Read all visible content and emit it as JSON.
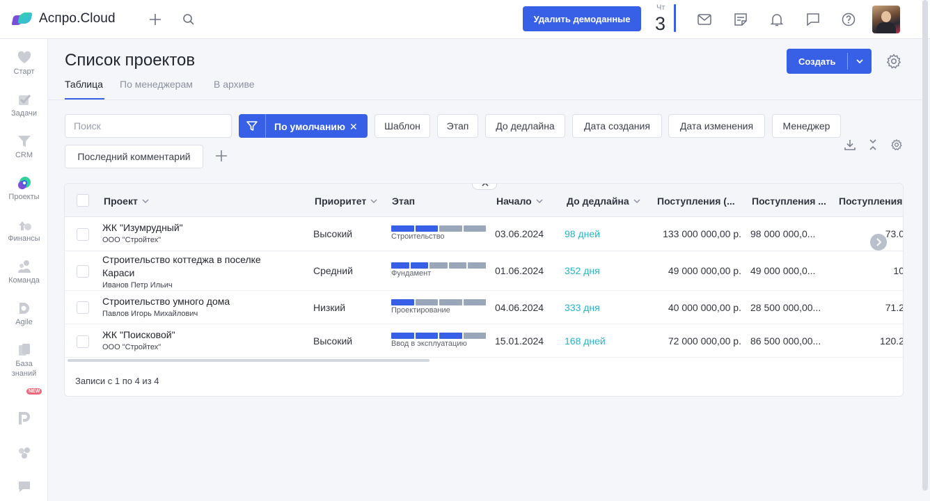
{
  "app": {
    "name": "Аспро.Cloud"
  },
  "topbar": {
    "delete_demo_label": "Удалить демоданные",
    "date": {
      "day_of_week": "Чт",
      "day": "3"
    }
  },
  "sidebar": {
    "items": [
      {
        "label": "Старт",
        "icon": "heart-icon"
      },
      {
        "label": "Задачи",
        "icon": "check-icon"
      },
      {
        "label": "CRM",
        "icon": "funnel-icon"
      },
      {
        "label": "Проекты",
        "icon": "projects-icon"
      },
      {
        "label": "Финансы",
        "icon": "finance-icon"
      },
      {
        "label": "Команда",
        "icon": "team-icon"
      },
      {
        "label": "Agile",
        "icon": "agile-icon"
      },
      {
        "label": "База знаний",
        "icon": "book-icon"
      }
    ],
    "new_badge": "NEW"
  },
  "page": {
    "title": "Список проектов",
    "tabs": [
      {
        "label": "Таблица",
        "active": true
      },
      {
        "label": "По менеджерам",
        "active": false
      },
      {
        "label": "В архиве",
        "active": false
      }
    ],
    "create_label": "Создать"
  },
  "filters": {
    "search_placeholder": "Поиск",
    "active_filter": "По умолчанию",
    "chips": [
      "Шаблон",
      "Этап",
      "До дедлайна",
      "Дата создания",
      "Дата изменения",
      "Менеджер",
      "Последний комментарий"
    ]
  },
  "table": {
    "columns": [
      "Проект",
      "Приоритет",
      "Этап",
      "Начало",
      "До дедлайна",
      "Поступления (...",
      "Поступления ...",
      "Поступления"
    ],
    "rows": [
      {
        "name": "ЖК \"Изумрудный\"",
        "sub": "ООО \"Стройтех\"",
        "priority": "Высокий",
        "stage": "Строительство",
        "stage_progress": 2,
        "start": "03.06.2024",
        "deadline": "98 дней",
        "income1": "133 000 000,00 р.",
        "income2": "98 000 000,0...",
        "income3": "73.0"
      },
      {
        "name": "Строительство коттеджа в поселке",
        "name2": "Караси",
        "sub": "Иванов Петр Ильич",
        "priority": "Средний",
        "stage": "Фундамент",
        "stage_progress": 2,
        "start": "01.06.2024",
        "deadline": "352 дня",
        "income1": "49 000 000,00 р.",
        "income2": "49 000 000,0...",
        "income3": "10"
      },
      {
        "name": "Строительство умного дома",
        "sub": "Павлов Игорь Михайлович",
        "priority": "Низкий",
        "stage": "Проектирование",
        "stage_progress": 1,
        "start": "04.06.2024",
        "deadline": "333 дня",
        "income1": "40 000 000,00 р.",
        "income2": "28 500 000,00...",
        "income3": "71.2"
      },
      {
        "name": "ЖК \"Поисковой\"",
        "sub": "ООО \"Стройтех\"",
        "priority": "Высокий",
        "stage": "Ввод в эксплуатацию",
        "stage_progress": 3,
        "start": "15.01.2024",
        "deadline": "168 дней",
        "income1": "72 000 000,00 р.",
        "income2": "86 500 000,00...",
        "income3": "120.2"
      }
    ],
    "records_label": "Записи с 1 по 4 из 4"
  },
  "colors": {
    "accent": "#3860e6",
    "deadline": "#28b2c8"
  }
}
